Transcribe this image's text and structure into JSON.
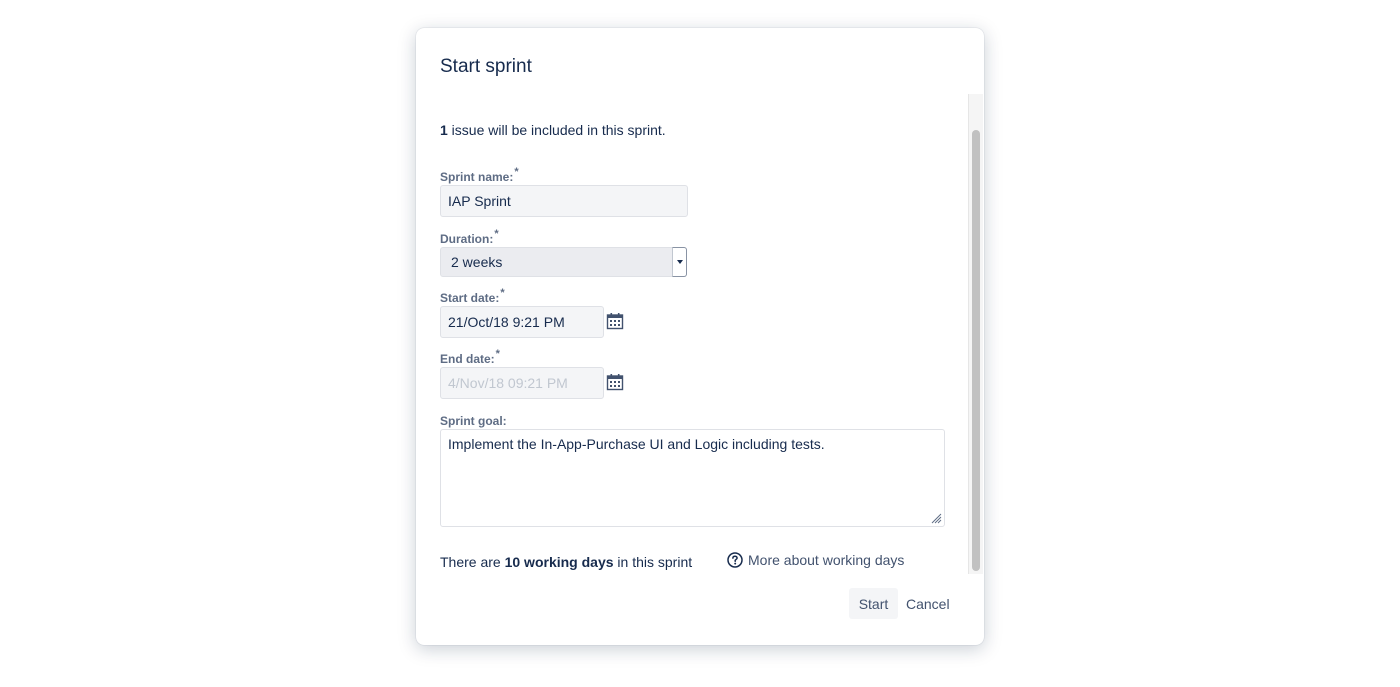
{
  "dialog": {
    "title": "Start sprint",
    "summary": {
      "count": "1",
      "text": " issue will be included in this sprint."
    },
    "fields": {
      "sprint_name": {
        "label": "Sprint name:",
        "required": "*",
        "value": "IAP Sprint"
      },
      "duration": {
        "label": "Duration:",
        "required": "*",
        "value": "2 weeks"
      },
      "start_date": {
        "label": "Start date:",
        "required": "*",
        "value": "21/Oct/18 9:21 PM"
      },
      "end_date": {
        "label": "End date:",
        "required": "*",
        "value": "4/Nov/18 09:21 PM",
        "disabled": true
      },
      "sprint_goal": {
        "label": "Sprint goal:",
        "value": "Implement the In-App-Purchase UI and Logic including tests."
      }
    },
    "working_days": {
      "prefix": "There are ",
      "count_text": "10 working days",
      "suffix": " in this sprint"
    },
    "help_link": {
      "label": "More about working days",
      "icon": "question-circle-icon"
    },
    "buttons": {
      "start": "Start",
      "cancel": "Cancel"
    }
  },
  "colors": {
    "text": "#172b4d",
    "label": "#5e6c84",
    "input_bg": "#f4f5f7",
    "border": "#dfe1e6"
  }
}
